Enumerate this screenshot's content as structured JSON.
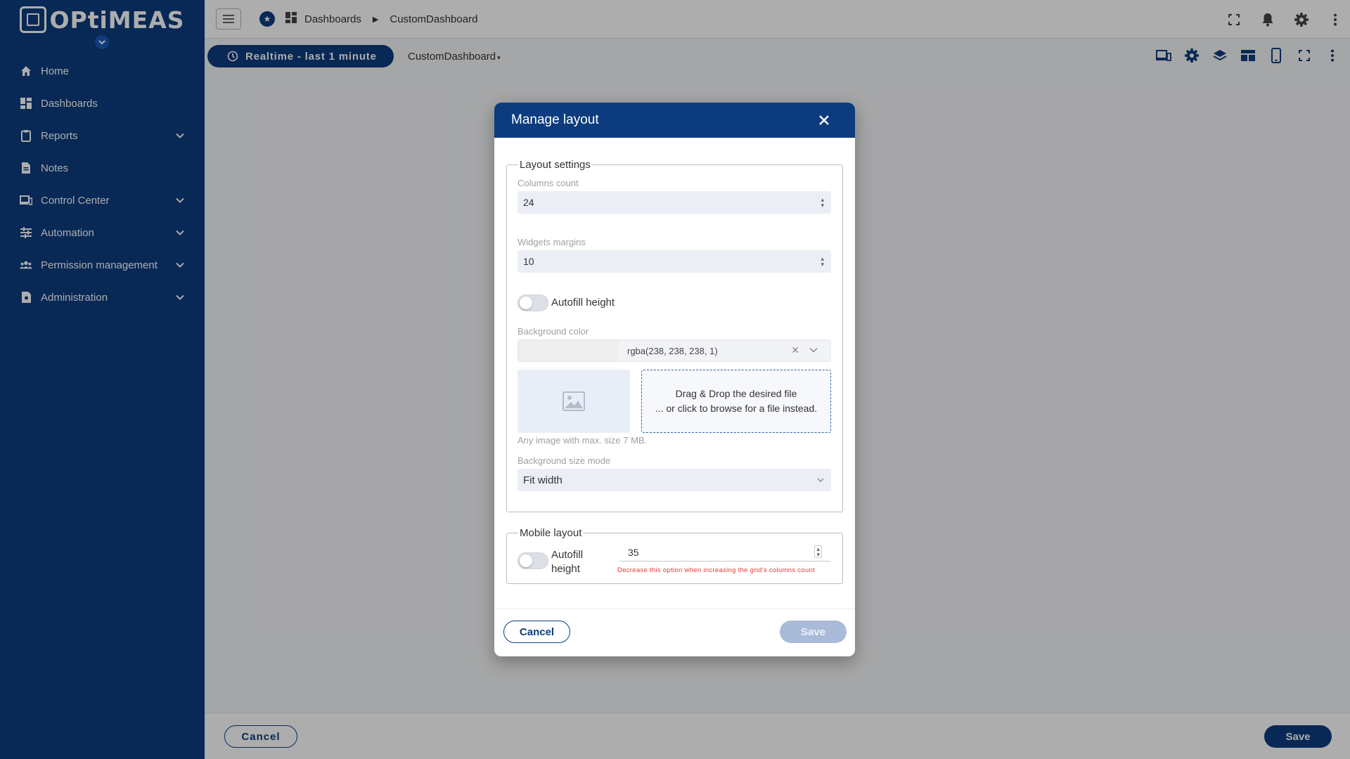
{
  "brand": {
    "logo_text": "OPtiMEAS"
  },
  "sidebar": {
    "items": [
      {
        "label": "Home",
        "icon": "home-icon",
        "expandable": false
      },
      {
        "label": "Dashboards",
        "icon": "dashboard-icon",
        "expandable": false
      },
      {
        "label": "Reports",
        "icon": "clipboard-icon",
        "expandable": true
      },
      {
        "label": "Notes",
        "icon": "document-icon",
        "expandable": false
      },
      {
        "label": "Control Center",
        "icon": "devices-icon",
        "expandable": true
      },
      {
        "label": "Automation",
        "icon": "tune-icon",
        "expandable": true
      },
      {
        "label": "Permission management",
        "icon": "group-icon",
        "expandable": true
      },
      {
        "label": "Administration",
        "icon": "admin-icon",
        "expandable": true
      }
    ]
  },
  "topbar": {
    "breadcrumb": [
      "Dashboards",
      "CustomDashboard"
    ]
  },
  "toolbar": {
    "timewindow_label": "Realtime - last 1 minute",
    "dashboard_select": "CustomDashboard"
  },
  "bottombar": {
    "cancel_label": "Cancel",
    "save_label": "Save"
  },
  "dialog": {
    "title": "Manage layout",
    "layout_settings": {
      "legend": "Layout settings",
      "columns_count_label": "Columns count",
      "columns_count_value": "24",
      "widgets_margins_label": "Widgets margins",
      "widgets_margins_value": "10",
      "autofill_height_label": "Autofill height",
      "autofill_height_on": false,
      "background_color_label": "Background color",
      "background_color_value": "rgba(238, 238, 238, 1)",
      "drop_line1": "Drag & Drop the desired file",
      "drop_line2": "... or click to browse for a file instead.",
      "image_hint": "Any image with max. size 7 MB.",
      "bg_size_mode_label": "Background size mode",
      "bg_size_mode_value": "Fit width"
    },
    "mobile_layout": {
      "legend": "Mobile layout",
      "autofill_line1": "Autofill",
      "autofill_line2": "height",
      "autofill_on": false,
      "row_height_value": "35",
      "warning": "Decrease this option when increasing the grid's columns count"
    },
    "cancel_label": "Cancel",
    "save_label": "Save"
  },
  "colors": {
    "primary": "#0c3c7e",
    "overlay": "rgba(0,0,0,0.32)",
    "background_swatch": "#eeeeee",
    "warning": "#e53935"
  }
}
